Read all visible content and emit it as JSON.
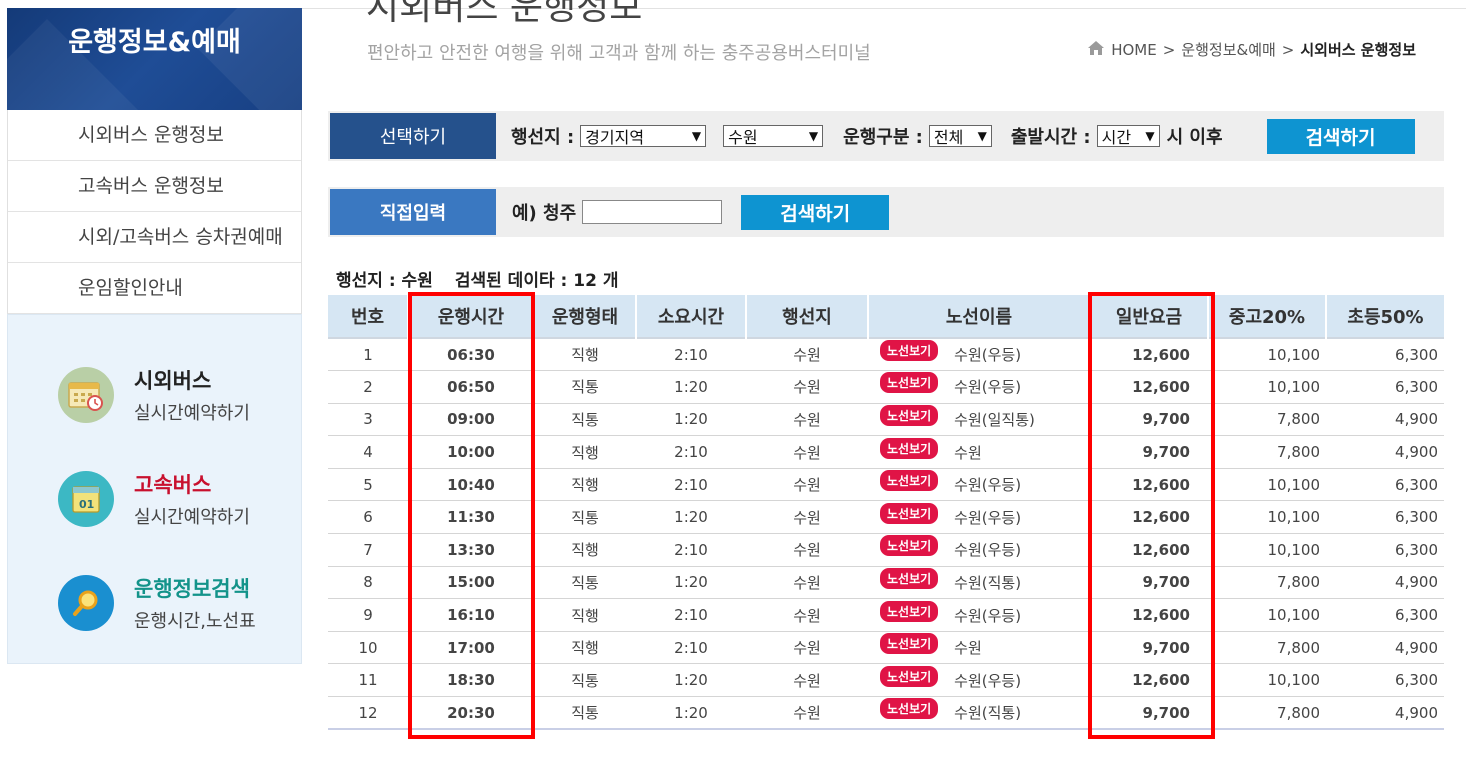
{
  "sidebar": {
    "title": "운행정보&예매",
    "menu": [
      "시외버스 운행정보",
      "고속버스 운행정보",
      "시외/고속버스 승차권예매",
      "운임할인안내"
    ],
    "quick": [
      {
        "title": "시외버스",
        "sub": "실시간예약하기",
        "color": "#222222",
        "icon": "calendar-clock-icon"
      },
      {
        "title": "고속버스",
        "sub": "실시간예약하기",
        "color": "#c8102e",
        "icon": "calendar-icon"
      },
      {
        "title": "운행정보검색",
        "sub": "운행시간,노선표",
        "color": "#13938a",
        "icon": "magnifier-icon"
      }
    ]
  },
  "header": {
    "title": "시외버스 운행정보",
    "subtitle": "편안하고 안전한 여행을 위해 고객과 함께 하는 충주공용버스터미널",
    "breadcrumb": {
      "home": "HOME",
      "sep": ">",
      "level1": "운행정보&예매",
      "current": "시외버스 운행정보"
    }
  },
  "search_select": {
    "tag": "선택하기",
    "dest_label": "행선지 :",
    "region_value": "경기지역",
    "city_value": "수원",
    "type_label": "운행구분 :",
    "type_value": "전체",
    "time_label": "출발시간 :",
    "time_value": "시간",
    "after_label": "시 이후",
    "button": "검색하기"
  },
  "search_direct": {
    "tag": "직접입력",
    "example": "예) 청주",
    "input_value": "",
    "button": "검색하기"
  },
  "result_info": {
    "dest": "행선지 : 수원",
    "count": "검색된 데이타 : 12 개"
  },
  "table": {
    "headers": [
      "번호",
      "운행시간",
      "운행형태",
      "소요시간",
      "행선지",
      "노선이름",
      "일반요금",
      "중고20%",
      "초등50%"
    ],
    "badge_label": "노선보기",
    "rows": [
      {
        "no": "1",
        "time": "06:30",
        "type": "직행",
        "dur": "2:10",
        "dest": "수원",
        "route": "수원(우등)",
        "fare": "12,600",
        "mid": "10,100",
        "elem": "6,300"
      },
      {
        "no": "2",
        "time": "06:50",
        "type": "직통",
        "dur": "1:20",
        "dest": "수원",
        "route": "수원(우등)",
        "fare": "12,600",
        "mid": "10,100",
        "elem": "6,300"
      },
      {
        "no": "3",
        "time": "09:00",
        "type": "직통",
        "dur": "1:20",
        "dest": "수원",
        "route": "수원(일직통)",
        "fare": "9,700",
        "mid": "7,800",
        "elem": "4,900"
      },
      {
        "no": "4",
        "time": "10:00",
        "type": "직행",
        "dur": "2:10",
        "dest": "수원",
        "route": "수원",
        "fare": "9,700",
        "mid": "7,800",
        "elem": "4,900"
      },
      {
        "no": "5",
        "time": "10:40",
        "type": "직행",
        "dur": "2:10",
        "dest": "수원",
        "route": "수원(우등)",
        "fare": "12,600",
        "mid": "10,100",
        "elem": "6,300"
      },
      {
        "no": "6",
        "time": "11:30",
        "type": "직통",
        "dur": "1:20",
        "dest": "수원",
        "route": "수원(우등)",
        "fare": "12,600",
        "mid": "10,100",
        "elem": "6,300"
      },
      {
        "no": "7",
        "time": "13:30",
        "type": "직행",
        "dur": "2:10",
        "dest": "수원",
        "route": "수원(우등)",
        "fare": "12,600",
        "mid": "10,100",
        "elem": "6,300"
      },
      {
        "no": "8",
        "time": "15:00",
        "type": "직통",
        "dur": "1:20",
        "dest": "수원",
        "route": "수원(직통)",
        "fare": "9,700",
        "mid": "7,800",
        "elem": "4,900"
      },
      {
        "no": "9",
        "time": "16:10",
        "type": "직행",
        "dur": "2:10",
        "dest": "수원",
        "route": "수원(우등)",
        "fare": "12,600",
        "mid": "10,100",
        "elem": "6,300"
      },
      {
        "no": "10",
        "time": "17:00",
        "type": "직행",
        "dur": "2:10",
        "dest": "수원",
        "route": "수원",
        "fare": "9,700",
        "mid": "7,800",
        "elem": "4,900"
      },
      {
        "no": "11",
        "time": "18:30",
        "type": "직통",
        "dur": "1:20",
        "dest": "수원",
        "route": "수원(우등)",
        "fare": "12,600",
        "mid": "10,100",
        "elem": "6,300"
      },
      {
        "no": "12",
        "time": "20:30",
        "type": "직통",
        "dur": "1:20",
        "dest": "수원",
        "route": "수원(직통)",
        "fare": "9,700",
        "mid": "7,800",
        "elem": "4,900"
      }
    ]
  },
  "colors": {
    "highlight": "#ff0000",
    "fare": "#e00000",
    "badge": "#e01446",
    "header_bg": "#d6e6f3",
    "button": "#0e94d1"
  }
}
